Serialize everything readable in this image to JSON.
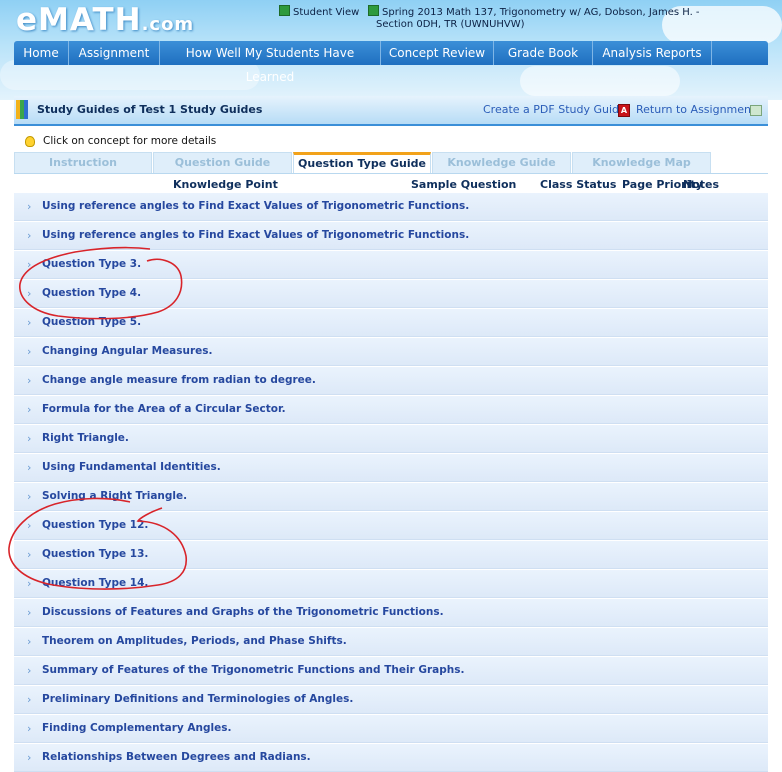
{
  "logo": {
    "main": "eMATH",
    "suffix": ".com"
  },
  "top_info": {
    "student_view": "Student View",
    "course_line1": "Spring 2013 Math 137, Trigonometry w/ AG, Dobson, James H. -",
    "course_line2": "Section 0DH, TR (UWNUHVW)"
  },
  "nav": {
    "items": [
      "Home",
      "Assignment",
      "How Well My Students Have Learned",
      "Concept Review",
      "Grade Book",
      "Analysis Reports"
    ]
  },
  "titlebar": {
    "title": "Study Guides of Test 1 Study Guides",
    "pdf_link": "Create a PDF Study Guide",
    "return_link": "Return to Assignment"
  },
  "hint": "Click on concept for more details",
  "tabs": [
    "Instruction",
    "Question Guide",
    "Question Type Guide",
    "Knowledge Guide",
    "Knowledge Map"
  ],
  "active_tab": "Question Type Guide",
  "table": {
    "headers": [
      "Knowledge Point",
      "Sample Question",
      "Class Status",
      "Page Priority",
      "Notes"
    ],
    "rows": [
      "Using reference angles to Find Exact Values of Trigonometric Functions.",
      "Using reference angles to Find Exact Values of Trigonometric Functions.",
      "Question Type 3.",
      "Question Type 4.",
      "Question Type 5.",
      "Changing Angular Measures.",
      "Change angle measure from radian to degree.",
      "Formula for the Area of a Circular Sector.",
      "Right Triangle.",
      "Using Fundamental Identities.",
      "Solving a Right Triangle.",
      "Question Type 12.",
      "Question Type 13.",
      "Question Type 14.",
      "Discussions of Features and Graphs of the Trigonometric Functions.",
      "Theorem on Amplitudes, Periods, and Phase Shifts.",
      "Summary of Features of the Trigonometric Functions and Their Graphs.",
      "Preliminary Definitions and Terminologies of Angles.",
      "Finding Complementary Angles.",
      "Relationships Between Degrees and Radians."
    ]
  },
  "colors": {
    "accent": "#1f6fc0",
    "tab_active_border": "#f2a21a",
    "row_text": "#26489f",
    "annotation": "#d8242a"
  },
  "icons": [
    "student-view-icon",
    "course-icon",
    "book-icon",
    "pdf-icon",
    "return-icon",
    "bulb-icon",
    "chevron-right-icon"
  ]
}
